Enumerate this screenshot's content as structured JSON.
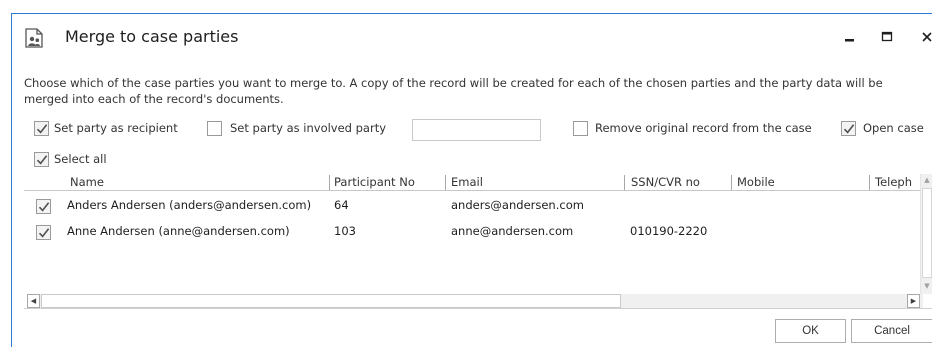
{
  "dialog": {
    "title": "Merge to case parties",
    "description": "Choose which of the case parties you want to merge to. A copy of the record will be created for each of the chosen parties and the party data will be merged into each of the record's documents.",
    "title_icon": "merge-parties-icon"
  },
  "window_controls": {
    "minimize_icon": "minimize-icon",
    "maximize_icon": "maximize-icon",
    "close_icon": "close-icon"
  },
  "options": {
    "set_recipient": {
      "label": "Set party as recipient",
      "checked": true
    },
    "set_involved": {
      "label": "Set party as involved party",
      "checked": false
    },
    "involved_input": {
      "value": "",
      "placeholder": ""
    },
    "remove_original": {
      "label": "Remove original record from the case",
      "checked": false
    },
    "open_case": {
      "label": "Open case",
      "checked": true
    }
  },
  "select_all": {
    "label": "Select all",
    "checked": true
  },
  "grid": {
    "columns": [
      "Name",
      "Participant No",
      "Email",
      "SSN/CVR no",
      "Mobile",
      "Teleph"
    ],
    "rows": [
      {
        "checked": true,
        "name": "Anders Andersen (anders@andersen.com)",
        "participant_no": "64",
        "email": "anders@andersen.com",
        "ssn": "",
        "mobile": "",
        "phone": ""
      },
      {
        "checked": true,
        "name": "Anne Andersen (anne@andersen.com)",
        "participant_no": "103",
        "email": "anne@andersen.com",
        "ssn": "010190-2220",
        "mobile": "",
        "phone": ""
      }
    ]
  },
  "buttons": {
    "ok": "OK",
    "cancel": "Cancel"
  },
  "colors": {
    "window_border": "#2b7bd0",
    "check_mark": "#505050"
  }
}
